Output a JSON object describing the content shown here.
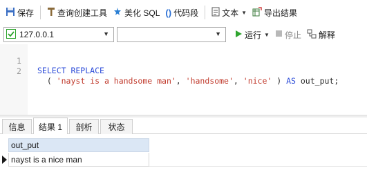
{
  "toolbar": {
    "save": "保存",
    "query_builder": "查询创建工具",
    "beautify_sql": "美化 SQL",
    "code_snippet": "代码段",
    "text": "文本",
    "export_results": "导出结果"
  },
  "connection": {
    "selected": "127.0.0.1",
    "database": "",
    "run": "运行",
    "stop": "停止",
    "explain": "解释"
  },
  "editor": {
    "lines": [
      {
        "num": "1",
        "tokens": [
          {
            "t": "SELECT REPLACE",
            "c": "kw"
          }
        ]
      },
      {
        "num": "2",
        "tokens": [
          {
            "t": "  ( ",
            "c": "plain"
          },
          {
            "t": "'nayst is a handsome man'",
            "c": "str"
          },
          {
            "t": ", ",
            "c": "plain"
          },
          {
            "t": "'handsome'",
            "c": "str"
          },
          {
            "t": ", ",
            "c": "plain"
          },
          {
            "t": "'nice'",
            "c": "str"
          },
          {
            "t": " ) ",
            "c": "plain"
          },
          {
            "t": "AS",
            "c": "kw"
          },
          {
            "t": " out_put;",
            "c": "plain"
          }
        ]
      }
    ]
  },
  "tabs": [
    "信息",
    "结果 1",
    "剖析",
    "状态"
  ],
  "result": {
    "columns": [
      "out_put"
    ],
    "rows": [
      [
        "nayst is a nice man"
      ]
    ]
  },
  "colors": {
    "keyword": "#2b4bd8",
    "string": "#c0392b",
    "header_bg": "#dbe7f5",
    "run_green": "#2fa52f"
  }
}
